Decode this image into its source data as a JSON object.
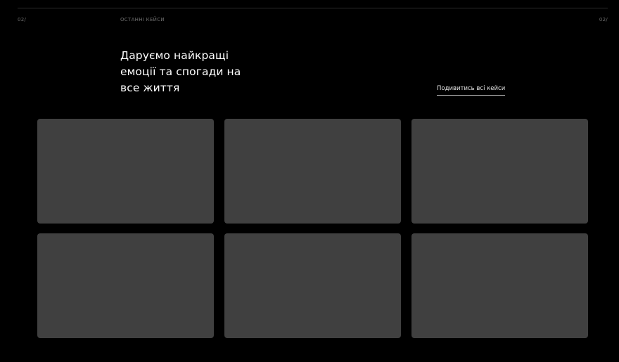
{
  "header": {
    "index_left": "02/",
    "section_label": "ОСТАННІ КЕЙСИ",
    "index_right": "02/"
  },
  "hero": {
    "headline": "Даруємо найкращі емоції та спогади на все життя",
    "view_all_label": "Подивитись всі кейси"
  },
  "colors": {
    "background": "#000000",
    "card": "#404040",
    "text": "#ffffff",
    "muted_text": "#6e6e6e"
  },
  "cases": {
    "count_rows": 2,
    "count_columns": 3
  }
}
